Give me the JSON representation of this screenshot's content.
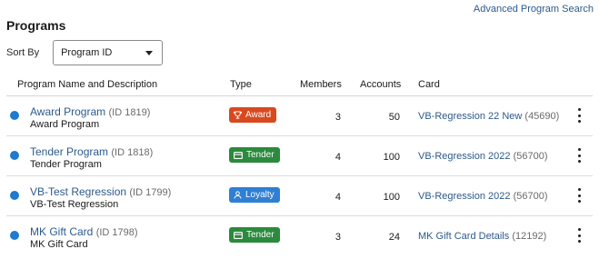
{
  "header": {
    "advanced_search": "Advanced Program Search",
    "title": "Programs"
  },
  "sort": {
    "label": "Sort By",
    "selected": "Program ID"
  },
  "table": {
    "columns": {
      "name": "Program Name and Description",
      "type": "Type",
      "members": "Members",
      "accounts": "Accounts",
      "card": "Card"
    },
    "rows": [
      {
        "name": "Award Program",
        "id": "(ID 1819)",
        "desc": "Award Program",
        "type": "Award",
        "type_icon": "trophy-icon",
        "members": "3",
        "accounts": "50",
        "card": "VB-Regression 22 New",
        "card_id": "(45690)"
      },
      {
        "name": "Tender Program",
        "id": "(ID 1818)",
        "desc": "Tender Program",
        "type": "Tender",
        "type_icon": "card-icon",
        "members": "4",
        "accounts": "100",
        "card": "VB-Regression 2022",
        "card_id": "(56700)"
      },
      {
        "name": "VB-Test Regression",
        "id": "(ID 1799)",
        "desc": "VB-Test Regression",
        "type": "Loyalty",
        "type_icon": "person-icon",
        "members": "4",
        "accounts": "100",
        "card": "VB-Regression 2022",
        "card_id": "(56700)"
      },
      {
        "name": "MK Gift Card",
        "id": "(ID 1798)",
        "desc": "MK Gift Card",
        "type": "Tender",
        "type_icon": "card-icon",
        "members": "3",
        "accounts": "24",
        "card": "MK Gift Card Details",
        "card_id": "(12192)"
      }
    ]
  },
  "colors": {
    "award": "#d8491f",
    "tender": "#2b8a3e",
    "loyalty": "#2f7fd3",
    "status_dot": "#1f7ad0",
    "link": "#2d5a8c"
  }
}
